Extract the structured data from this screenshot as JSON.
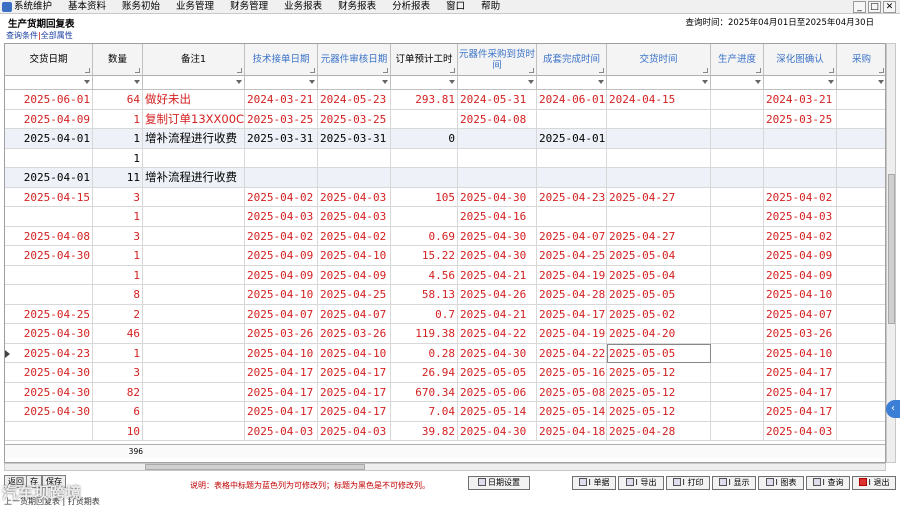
{
  "menu": [
    "系统维护",
    "基本资料",
    "账务初始",
    "业务管理",
    "财务管理",
    "业务报表",
    "财务报表",
    "分析报表",
    "窗口",
    "帮助"
  ],
  "window_controls": [
    "_",
    "□",
    "✕"
  ],
  "form_title": "生产货期回复表",
  "query_time": "查询时间：2025年04月01日至2025年04月30日",
  "filter_links": {
    "a": "查询条件",
    "sep": "|",
    "b": "全部属性"
  },
  "columns": [
    {
      "label": "交货日期",
      "editable": false
    },
    {
      "label": "数量",
      "editable": false
    },
    {
      "label": "备注1",
      "editable": false
    },
    {
      "label": "技术接单日期",
      "editable": true
    },
    {
      "label": "元器件审核日期",
      "editable": true
    },
    {
      "label": "订单预计工时",
      "editable": false
    },
    {
      "label": "元器件采购到货时间",
      "editable": true
    },
    {
      "label": "成套完成时间",
      "editable": true
    },
    {
      "label": "交货时间",
      "editable": true
    },
    {
      "label": "生产进度",
      "editable": true
    },
    {
      "label": "深化图确认",
      "editable": true
    },
    {
      "label": "采购",
      "editable": true
    }
  ],
  "rows": [
    {
      "color": "red",
      "c": [
        "2025-06-01",
        "64",
        "做好未出",
        "2024-03-21",
        "2024-05-23",
        "293.81",
        "2024-05-31",
        "2024-06-01",
        "2024-04-15",
        "",
        "2024-03-21",
        ""
      ]
    },
    {
      "color": "red",
      "c": [
        "2025-04-09",
        "1",
        "复制订单13XX00C",
        "2025-03-25",
        "2025-03-25",
        "",
        "2025-04-08",
        "",
        "",
        "",
        "2025-03-25",
        ""
      ]
    },
    {
      "color": "blk",
      "c": [
        "2025-04-01",
        "1",
        "增补流程进行收费",
        "2025-03-31",
        "2025-03-31",
        "0",
        "",
        "2025-04-01",
        "",
        "",
        "",
        ""
      ]
    },
    {
      "color": "blk",
      "c": [
        "",
        "1",
        "",
        "",
        "",
        "",
        "",
        "",
        "",
        "",
        "",
        ""
      ]
    },
    {
      "color": "blk",
      "c": [
        "2025-04-01",
        "11",
        "增补流程进行收费",
        "",
        "",
        "",
        "",
        "",
        "",
        "",
        "",
        ""
      ]
    },
    {
      "color": "red",
      "c": [
        "2025-04-15",
        "3",
        "",
        "2025-04-02",
        "2025-04-03",
        "105",
        "2025-04-30",
        "2025-04-23",
        "2025-04-27",
        "",
        "2025-04-02",
        ""
      ]
    },
    {
      "color": "red",
      "c": [
        "",
        "1",
        "",
        "2025-04-03",
        "2025-04-03",
        "",
        "2025-04-16",
        "",
        "",
        "",
        "2025-04-03",
        ""
      ]
    },
    {
      "color": "red",
      "c": [
        "2025-04-08",
        "3",
        "",
        "2025-04-02",
        "2025-04-02",
        "0.69",
        "2025-04-30",
        "2025-04-07",
        "2025-04-27",
        "",
        "2025-04-02",
        ""
      ]
    },
    {
      "color": "red",
      "c": [
        "2025-04-30",
        "1",
        "",
        "2025-04-09",
        "2025-04-10",
        "15.22",
        "2025-04-30",
        "2025-04-25",
        "2025-05-04",
        "",
        "2025-04-09",
        ""
      ]
    },
    {
      "color": "red",
      "c": [
        "",
        "1",
        "",
        "2025-04-09",
        "2025-04-09",
        "4.56",
        "2025-04-21",
        "2025-04-19",
        "2025-05-04",
        "",
        "2025-04-09",
        ""
      ]
    },
    {
      "color": "red",
      "c": [
        "",
        "8",
        "",
        "2025-04-10",
        "2025-04-25",
        "58.13",
        "2025-04-26",
        "2025-04-28",
        "2025-05-05",
        "",
        "2025-04-10",
        ""
      ]
    },
    {
      "color": "red",
      "c": [
        "2025-04-25",
        "2",
        "",
        "2025-04-07",
        "2025-04-07",
        "0.7",
        "2025-04-21",
        "2025-04-17",
        "2025-05-02",
        "",
        "2025-04-07",
        ""
      ]
    },
    {
      "color": "red",
      "c": [
        "2025-04-30",
        "46",
        "",
        "2025-03-26",
        "2025-03-26",
        "119.38",
        "2025-04-22",
        "2025-04-19",
        "2025-04-20",
        "",
        "2025-03-26",
        ""
      ]
    },
    {
      "color": "red",
      "c": [
        "2025-04-23",
        "1",
        "",
        "2025-04-10",
        "2025-04-10",
        "0.28",
        "2025-04-30",
        "2025-04-22",
        "2025-05-05",
        "",
        "2025-04-10",
        ""
      ]
    },
    {
      "color": "red",
      "c": [
        "2025-04-30",
        "3",
        "",
        "2025-04-17",
        "2025-04-17",
        "26.94",
        "2025-05-05",
        "2025-05-16",
        "2025-05-12",
        "",
        "2025-04-17",
        ""
      ]
    },
    {
      "color": "red",
      "c": [
        "2025-04-30",
        "82",
        "",
        "2025-04-17",
        "2025-04-17",
        "670.34",
        "2025-05-06",
        "2025-05-08",
        "2025-05-12",
        "",
        "2025-04-17",
        ""
      ]
    },
    {
      "color": "red",
      "c": [
        "2025-04-30",
        "6",
        "",
        "2025-04-17",
        "2025-04-17",
        "7.04",
        "2025-05-14",
        "2025-05-14",
        "2025-05-12",
        "",
        "2025-04-17",
        ""
      ]
    },
    {
      "color": "red",
      "c": [
        "",
        "10",
        "",
        "2025-04-03",
        "2025-04-03",
        "39.82",
        "2025-04-30",
        "2025-04-18",
        "2025-04-28",
        "",
        "2025-04-03",
        ""
      ]
    }
  ],
  "total_qty": "396",
  "note": "说明：表格中标题为蓝色列为可修改列；标题为黑色是不可修改列。",
  "buttons": {
    "date_setting": "日期设置",
    "toolbar": [
      "I 单据",
      "I 导出",
      "I 打印",
      "I 显示",
      "I 图表",
      "I 查询",
      "I 退出"
    ]
  },
  "left_buttons": [
    "返回",
    "存",
    "保存"
  ],
  "footer_tabs": "上一货期回复表 | 打货期表",
  "watermark": "汽车坝跨境",
  "side_arrow": "‹"
}
